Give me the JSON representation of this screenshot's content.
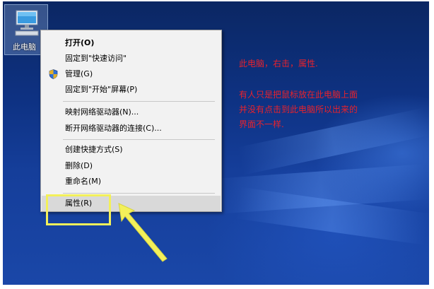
{
  "desktop": {
    "icon_label": "此电脑",
    "icon_name": "computer-icon"
  },
  "context_menu": {
    "items": [
      {
        "label": "打开(O)",
        "bold": true
      },
      {
        "label": "固定到\"快速访问\""
      },
      {
        "label": "管理(G)",
        "icon": "uac-shield-icon"
      },
      {
        "label": "固定到\"开始\"屏幕(P)"
      },
      {
        "label": "映射网络驱动器(N)..."
      },
      {
        "label": "断开网络驱动器的连接(C)..."
      },
      {
        "label": "创建快捷方式(S)"
      },
      {
        "label": "删除(D)"
      },
      {
        "label": "重命名(M)"
      },
      {
        "label": "属性(R)",
        "highlighted": true
      }
    ]
  },
  "annotation": {
    "line1": "此电脑，右击，属性.",
    "line2": "有人只是把鼠标放在此电脑上面",
    "line3": "并没有点击到此电脑所以出来的",
    "line4": "界面不一样.",
    "text_color": "#e8222c",
    "highlight_color": "#f3f05a"
  }
}
